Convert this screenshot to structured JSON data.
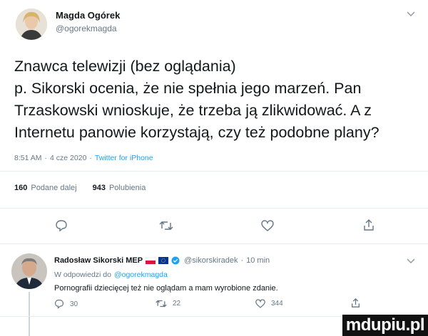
{
  "author": {
    "name": "Magda Ogórek",
    "handle": "@ogorekmagda"
  },
  "tweet": {
    "text_lines": [
      "Znawca telewizji (bez oglądania)",
      "p. Sikorski ocenia, że nie spełnia jego marzeń. Pan",
      "Trzaskowski wnioskuje, że trzeba ją zlikwidować. A z",
      "Internetu panowie korzystają, czy też podobne plany?"
    ],
    "time": "8:51 AM",
    "date": "4 cze 2020",
    "source": "Twitter for iPhone",
    "sep": "·"
  },
  "stats": {
    "retweets_count": "160",
    "retweets_label": "Podane dalej",
    "likes_count": "943",
    "likes_label": "Polubienia"
  },
  "reply": {
    "name": "Radosław Sikorski MEP",
    "handle": "@sikorskiradek",
    "time": "10 min",
    "replying_prefix": "W odpowiedzi do",
    "replying_to": "@ogorekmagda",
    "text": "Pornografii dziecięcej też nie oglądam a mam wyrobione zdanie.",
    "reply_count": "30",
    "retweet_count": "22",
    "like_count": "344"
  },
  "watermark": "mdupiu.pl",
  "colors": {
    "accent": "#1da1f2",
    "muted": "#657786",
    "text": "#14171a",
    "divider": "#e6ecf0"
  }
}
